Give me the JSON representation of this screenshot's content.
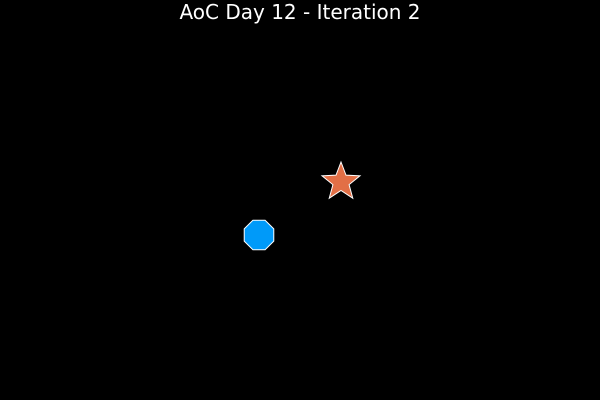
{
  "chart_data": {
    "type": "scatter",
    "title": "AoC Day 12 - Iteration 2",
    "xlabel": "",
    "ylabel": "",
    "grid": false,
    "axes_visible": false,
    "background_color": "#000000",
    "title_color": "#ffffff",
    "series": [
      {
        "marker": "octagon",
        "color": "#009af9",
        "edge_color": "#ffffff",
        "x": [
          0
        ],
        "y": [
          0
        ]
      },
      {
        "marker": "star5",
        "color": "#e26f46",
        "edge_color": "#ffffff",
        "x": [
          1
        ],
        "y": [
          1
        ]
      }
    ]
  }
}
